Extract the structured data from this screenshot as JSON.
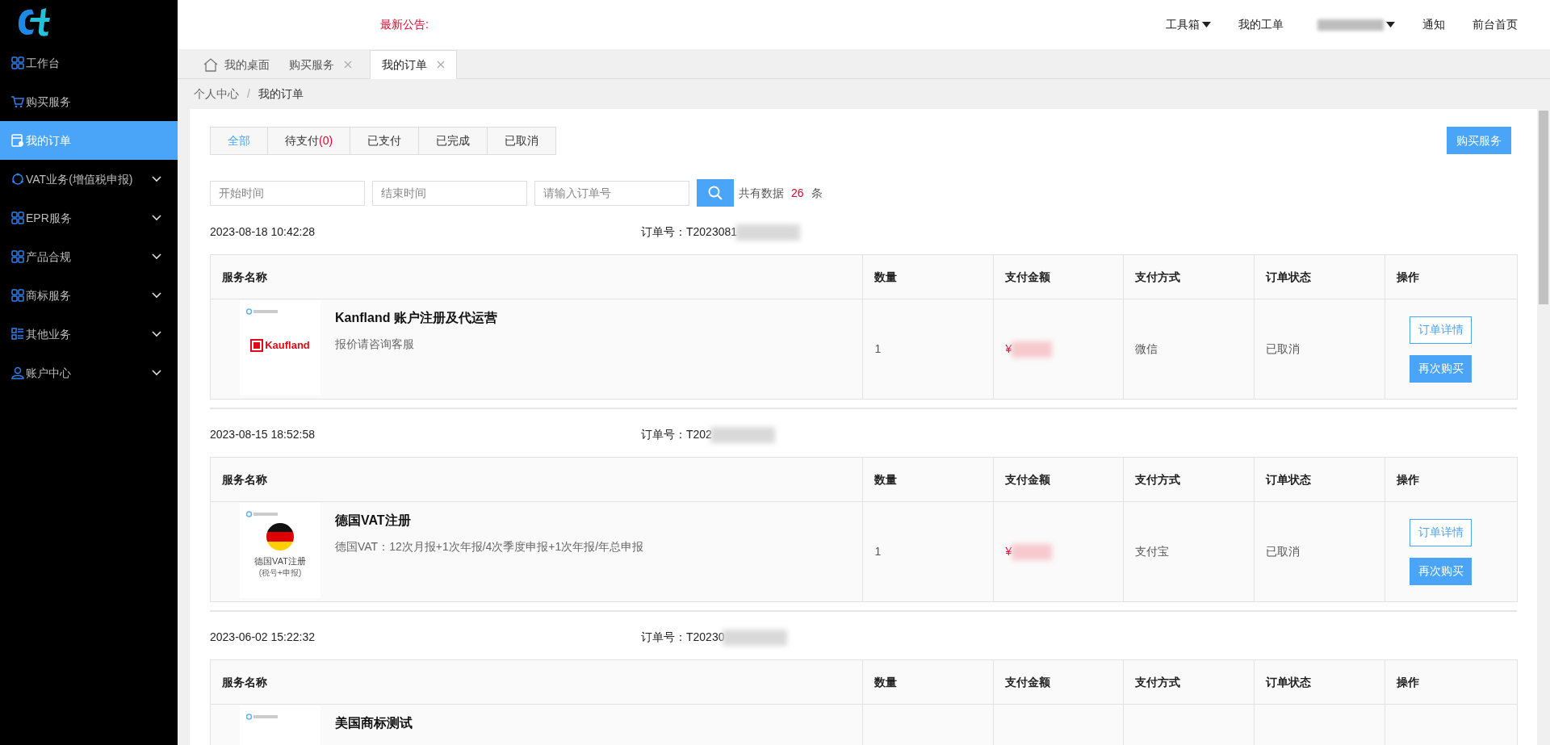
{
  "sidebar": {
    "items": [
      {
        "label": "工作台",
        "kind": "grid",
        "selected": false,
        "expandable": false
      },
      {
        "label": "购买服务",
        "kind": "cart",
        "selected": false,
        "expandable": false
      },
      {
        "label": "我的订单",
        "kind": "order",
        "selected": true,
        "expandable": false
      },
      {
        "label": "VAT业务(增值税申报)",
        "kind": "cycle",
        "selected": false,
        "expandable": true
      },
      {
        "label": "EPR服务",
        "kind": "grid",
        "selected": false,
        "expandable": true
      },
      {
        "label": "产品合规",
        "kind": "grid",
        "selected": false,
        "expandable": true
      },
      {
        "label": "商标服务",
        "kind": "grid",
        "selected": false,
        "expandable": true
      },
      {
        "label": "其他业务",
        "kind": "list",
        "selected": false,
        "expandable": true
      },
      {
        "label": "账户中心",
        "kind": "user",
        "selected": false,
        "expandable": true
      }
    ]
  },
  "header": {
    "notice_label": "最新公告:",
    "menu": [
      {
        "kind": "dropdown",
        "label": "工具箱"
      },
      {
        "kind": "link",
        "label": "我的工单"
      },
      {
        "kind": "redacted_dropdown"
      },
      {
        "kind": "link",
        "label": "通知"
      },
      {
        "kind": "link",
        "label": "前台首页"
      }
    ]
  },
  "tabs": [
    {
      "label": "我的桌面",
      "home": true,
      "closable": false,
      "selected": false
    },
    {
      "label": "购买服务",
      "home": false,
      "closable": true,
      "selected": false
    },
    {
      "label": "我的订单",
      "home": false,
      "closable": true,
      "selected": true
    }
  ],
  "breadcrumb": {
    "items": [
      "个人中心",
      "我的订单"
    ],
    "separator": "/"
  },
  "filter_tabs": [
    {
      "label": "全部",
      "selected": true
    },
    {
      "label": "待支付",
      "count": "(0)",
      "selected": false
    },
    {
      "label": "已支付",
      "selected": false
    },
    {
      "label": "已完成",
      "selected": false
    },
    {
      "label": "已取消",
      "selected": false
    }
  ],
  "buy_button": "购买服务",
  "search": {
    "start_placeholder": "开始时间",
    "end_placeholder": "结束时间",
    "order_placeholder": "请输入订单号",
    "total_prefix": "共有数据",
    "total_count": "26",
    "total_suffix": "条"
  },
  "orders": [
    {
      "date": "2023-08-18 10:42:28",
      "order_no_label": "订单号：",
      "order_no": "T2023081",
      "columns": [
        "服务名称",
        "数量",
        "支付金额",
        "支付方式",
        "订单状态",
        "操作"
      ],
      "item": {
        "kind": "kaufland",
        "image_text": "Kaufland",
        "name": "Kanfland 账户注册及代运营",
        "description": "报价请咨询客服",
        "quantity": "1",
        "amount": "¥",
        "payment": "微信",
        "status": "已取消",
        "actions": [
          "订单详情",
          "再次购买"
        ]
      }
    },
    {
      "date": "2023-08-15 18:52:58",
      "order_no_label": "订单号：",
      "order_no": "T202",
      "columns": [
        "服务名称",
        "数量",
        "支付金额",
        "支付方式",
        "订单状态",
        "操作"
      ],
      "item": {
        "kind": "germany",
        "image_text": "德国VAT注册",
        "image_subtext": "(税号+申报)",
        "name": "德国VAT注册",
        "description": "德国VAT：12次月报+1次年报/4次季度申报+1次年报/年总申报",
        "quantity": "1",
        "amount": "¥",
        "payment": "支付宝",
        "status": "已取消",
        "actions": [
          "订单详情",
          "再次购买"
        ]
      }
    },
    {
      "date": "2023-06-02 15:22:32",
      "order_no_label": "订单号：",
      "order_no": "T20230",
      "columns": [
        "服务名称",
        "数量",
        "支付金额",
        "支付方式",
        "订单状态",
        "操作"
      ],
      "item": {
        "kind": "brand",
        "name": "美国商标测试"
      }
    }
  ]
}
